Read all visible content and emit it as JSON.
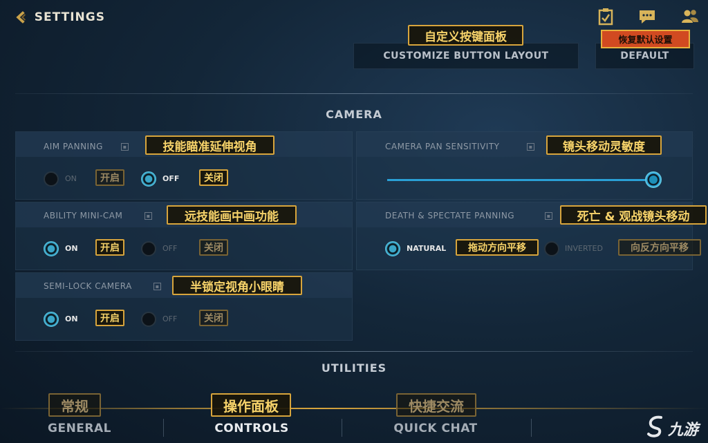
{
  "header": {
    "title": "SETTINGS",
    "icons": [
      "checklist-icon",
      "chat-icon",
      "friends-icon"
    ]
  },
  "top_buttons": {
    "customize": "CUSTOMIZE BUTTON LAYOUT",
    "customize_cn": "自定义按键面板",
    "default": "DEFAULT",
    "default_cn": "恢复默认设置"
  },
  "camera": {
    "title": "CAMERA",
    "aim_panning": {
      "label": "AIM PANNING",
      "label_cn": "技能瞄准延伸视角",
      "on": "ON",
      "on_cn": "开启",
      "off": "OFF",
      "off_cn": "关闭",
      "selected": "off"
    },
    "camera_pan_sensitivity": {
      "label": "CAMERA PAN SENSITIVITY",
      "label_cn": "镜头移动灵敏度",
      "value": 1.0
    },
    "ability_mini_cam": {
      "label": "ABILITY MINI-CAM",
      "label_cn": "远技能画中画功能",
      "on": "ON",
      "on_cn": "开启",
      "off": "OFF",
      "off_cn": "关闭",
      "selected": "on"
    },
    "death_spectate_panning": {
      "label": "DEATH & SPECTATE PANNING",
      "label_cn": "死亡 & 观战镜头移动",
      "natural": "NATURAL",
      "natural_cn": "拖动方向平移",
      "inverted": "INVERTED",
      "inverted_cn": "向反方向平移",
      "selected": "natural"
    },
    "semi_lock_camera": {
      "label": "SEMI-LOCK CAMERA",
      "label_cn": "半锁定视角小眼睛",
      "on": "ON",
      "on_cn": "开启",
      "off": "OFF",
      "off_cn": "关闭",
      "selected": "on"
    }
  },
  "utilities": {
    "title": "UTILITIES"
  },
  "bottom_nav": {
    "general": "GENERAL",
    "general_cn": "常规",
    "controls": "CONTROLS",
    "controls_cn": "操作面板",
    "quick_chat": "QUICK CHAT",
    "quick_chat_cn": "快捷交流",
    "active": "controls"
  },
  "watermark": {
    "text": "九游"
  },
  "colors": {
    "accent_gold": "#d8a53c",
    "accent_blue": "#2aa0d6",
    "annotation_red": "#d14a21",
    "background": "#132638"
  }
}
